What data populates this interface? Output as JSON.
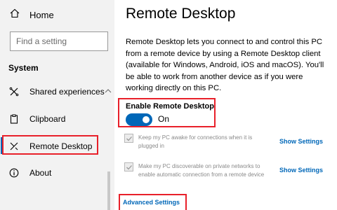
{
  "sidebar": {
    "home_label": "Home",
    "search_placeholder": "Find a setting",
    "section_title": "System",
    "items": [
      {
        "label": "Shared experiences",
        "icon": "shared-experiences-icon"
      },
      {
        "label": "Clipboard",
        "icon": "clipboard-icon"
      },
      {
        "label": "Remote Desktop",
        "icon": "remote-desktop-icon",
        "selected": true
      },
      {
        "label": "About",
        "icon": "info-icon"
      }
    ]
  },
  "main": {
    "title": "Remote Desktop",
    "description": "Remote Desktop lets you connect to and control this PC from a remote device by using a Remote Desktop client (available for Windows, Android, iOS and macOS). You'll be able to work from another device as if you were working directly on this PC.",
    "enable": {
      "label": "Enable Remote Desktop",
      "state": "On"
    },
    "options": [
      {
        "text": "Keep my PC awake for connections when it is plugged in",
        "link": "Show Settings",
        "checked": true
      },
      {
        "text": "Make my PC discoverable on private networks to enable automatic connection from a remote device",
        "link": "Show Settings",
        "checked": true
      }
    ],
    "advanced_link": "Advanced Settings"
  },
  "colors": {
    "accent": "#0067b8",
    "highlight_box": "#e8202a",
    "sidebar_bg": "#f2f2f2"
  }
}
